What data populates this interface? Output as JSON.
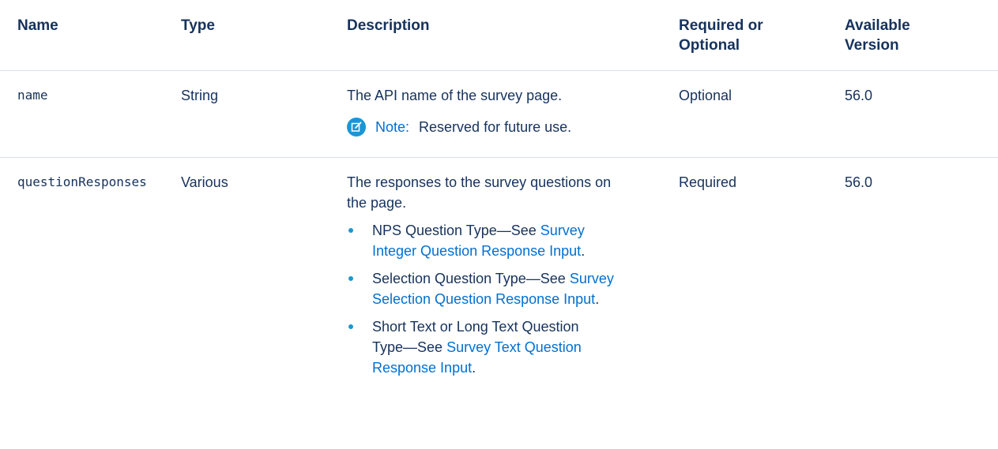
{
  "columns": {
    "name": "Name",
    "type": "Type",
    "description": "Description",
    "required_line1": "Required or",
    "required_line2": "Optional",
    "version_line1": "Available",
    "version_line2": "Version"
  },
  "rows": [
    {
      "name": "name",
      "type": "String",
      "description": "The API name of the survey page.",
      "note_label": "Note:",
      "note_text": "Reserved for future use.",
      "required": "Optional",
      "version": "56.0"
    },
    {
      "name": "questionResponses",
      "type": "Various",
      "description_line1": "The responses to the survey questions on",
      "description_line2": "the page.",
      "bullets": [
        {
          "line1_text": "NPS Question Type—See ",
          "line1_link": "Survey",
          "line2_link": "Integer Question Response Input",
          "line2_text": "."
        },
        {
          "line1_text": "Selection Question Type—See ",
          "line1_link": "Survey",
          "line2_link": "Selection Question Response Input",
          "line2_text": "."
        },
        {
          "line1_text": "Short Text or Long Text Question",
          "line2_text": "Type—See ",
          "line2_link": "Survey Text Question",
          "line3_link": "Response Input",
          "line3_text": "."
        }
      ],
      "required": "Required",
      "version": "56.0"
    }
  ],
  "colors": {
    "text": "#16325c",
    "link": "#0070d2",
    "accent": "#1b96d4",
    "divider": "#d8dde6"
  },
  "icons": {
    "note": "edit-note-icon"
  }
}
